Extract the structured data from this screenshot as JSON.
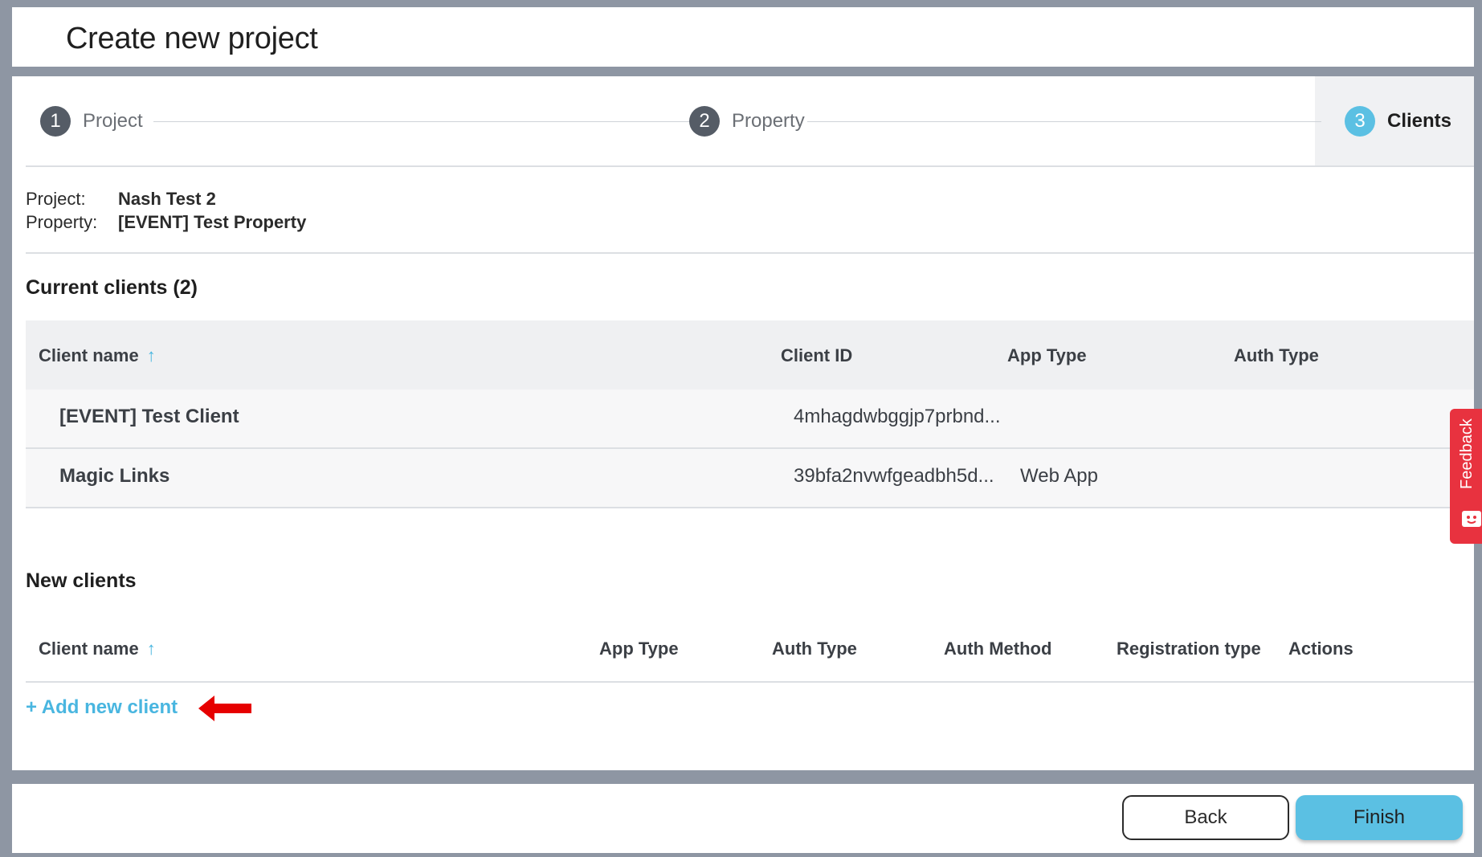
{
  "header": {
    "title": "Create new project"
  },
  "stepper": {
    "steps": [
      {
        "number": "1",
        "label": "Project"
      },
      {
        "number": "2",
        "label": "Property"
      },
      {
        "number": "3",
        "label": "Clients"
      }
    ],
    "active_step": 3
  },
  "summary": {
    "project_label": "Project:",
    "project_value": "Nash Test 2",
    "property_label": "Property:",
    "property_value": "[EVENT] Test Property"
  },
  "current_clients": {
    "title": "Current clients (2)",
    "columns": [
      "Client name",
      "Client ID",
      "App Type",
      "Auth Type"
    ],
    "sort_indicator": "↑",
    "rows": [
      {
        "name": "[EVENT] Test Client",
        "client_id": "4mhagdwbggjp7prbnd...",
        "app_type": "",
        "auth_type": ""
      },
      {
        "name": "Magic Links",
        "client_id": "39bfa2nvwfgeadbh5d...",
        "app_type": "Web App",
        "auth_type": ""
      }
    ]
  },
  "new_clients": {
    "title": "New clients",
    "columns": [
      "Client name",
      "App Type",
      "Auth Type",
      "Auth Method",
      "Registration type",
      "Actions"
    ],
    "sort_indicator": "↑",
    "add_link": "+ Add new client"
  },
  "feedback": {
    "label": "Feedback"
  },
  "footer": {
    "back_label": "Back",
    "finish_label": "Finish"
  },
  "colors": {
    "accent": "#5bc0e3",
    "link": "#49b6e0",
    "feedback": "#e8323f",
    "arrow": "#e60000"
  }
}
